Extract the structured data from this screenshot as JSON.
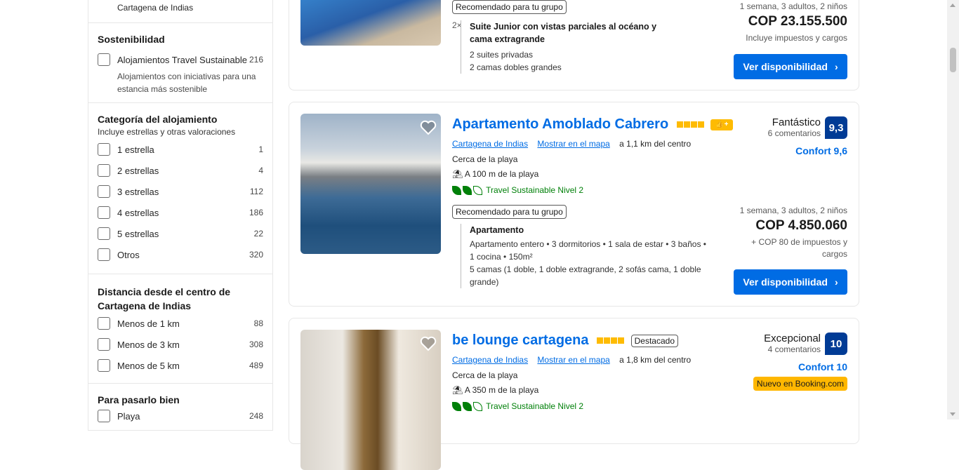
{
  "sidebar": {
    "top_item": "Cartagena de Indias",
    "sostenibilidad": {
      "title": "Sostenibilidad",
      "item_label": "Alojamientos Travel Sustainable",
      "item_count": "216",
      "item_desc": "Alojamientos con iniciativas para una estancia más sostenible"
    },
    "categoria": {
      "title": "Categoría del alojamiento",
      "subtitle": "Incluye estrellas y otras valoraciones",
      "items": [
        {
          "label": "1 estrella",
          "count": "1"
        },
        {
          "label": "2 estrellas",
          "count": "4"
        },
        {
          "label": "3 estrellas",
          "count": "112"
        },
        {
          "label": "4 estrellas",
          "count": "186"
        },
        {
          "label": "5 estrellas",
          "count": "22"
        },
        {
          "label": "Otros",
          "count": "320"
        }
      ]
    },
    "distancia": {
      "title": "Distancia desde el centro de Cartagena de Indias",
      "items": [
        {
          "label": "Menos de 1 km",
          "count": "88"
        },
        {
          "label": "Menos de 3 km",
          "count": "308"
        },
        {
          "label": "Menos de 5 km",
          "count": "489"
        }
      ]
    },
    "pasarlo": {
      "title": "Para pasarlo bien",
      "items": [
        {
          "label": "Playa",
          "count": "248"
        }
      ]
    }
  },
  "card1": {
    "tag": "Recomendado para tu grupo",
    "qty": "2×",
    "room_name": "Suite Junior con vistas parciales al océano y cama extragrande",
    "room_line1": "2 suites privadas",
    "room_line2": "2 camas dobles grandes",
    "stay": "1 semana, 3 adultos, 2 niños",
    "price": "COP 23.155.500",
    "taxes": "Incluye impuestos y cargos",
    "button": "Ver disponibilidad"
  },
  "card2": {
    "title": "Apartamento Amoblado Cabrero",
    "city_link": "Cartagena de Indias",
    "map_link": "Mostrar en el mapa",
    "distance": "a 1,1 km del centro",
    "beach_near": "Cerca de la playa",
    "beach_dist": "A 100 m de la playa",
    "sustainable": "Travel Sustainable Nivel 2",
    "tag": "Recomendado para tu grupo",
    "room_name": "Apartamento",
    "room_desc": "Apartamento entero • 3 dormitorios • 1 sala de estar • 3 baños • 1 cocina • 150m²",
    "beds": "5 camas (1 doble, 1 doble extragrande, 2 sofás cama, 1 doble grande)",
    "rating_word": "Fantástico",
    "rating_count": "6 comentarios",
    "score": "9,3",
    "confort": "Confort 9,6",
    "stay": "1 semana, 3 adultos, 2 niños",
    "price": "COP 4.850.060",
    "taxes": "+ COP 80 de impuestos y cargos",
    "button": "Ver disponibilidad"
  },
  "card3": {
    "title": "be lounge cartagena",
    "badge": "Destacado",
    "city_link": "Cartagena de Indias",
    "map_link": "Mostrar en el mapa",
    "distance": "a 1,8 km del centro",
    "beach_near": "Cerca de la playa",
    "beach_dist": "A 350 m de la playa",
    "sustainable": "Travel Sustainable Nivel 2",
    "rating_word": "Excepcional",
    "rating_count": "4 comentarios",
    "score": "10",
    "confort": "Confort 10",
    "new_badge": "Nuevo en Booking.com"
  },
  "colors": {
    "accent": "#006ce4",
    "score_bg": "#003b95",
    "star": "#febb02",
    "green": "#008009"
  }
}
